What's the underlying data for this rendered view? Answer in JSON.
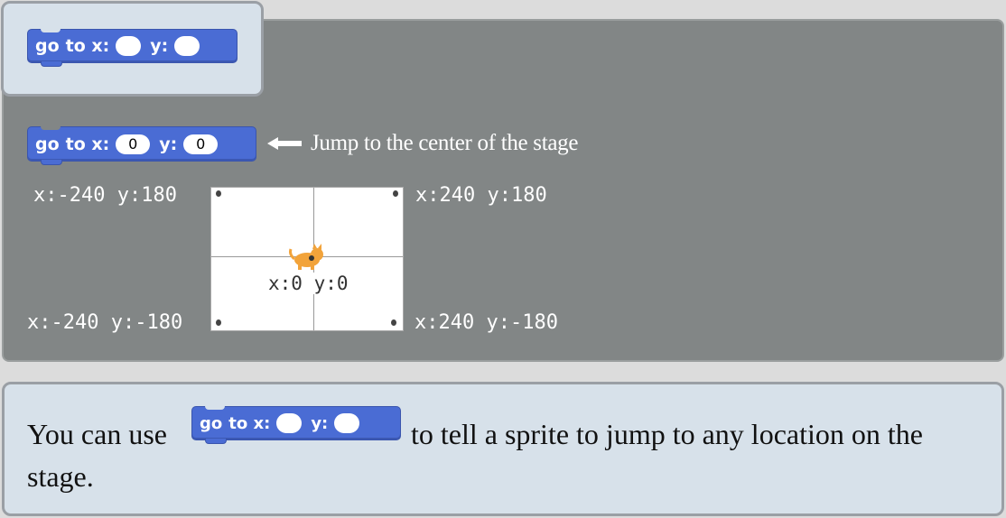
{
  "block": {
    "text_go": "go",
    "text_to_x": "to x:",
    "text_y": "y:"
  },
  "example_block": {
    "x_value": "0",
    "y_value": "0"
  },
  "hint": "Jump to the center of the stage",
  "stage": {
    "top_left": "x:-240 y:180",
    "top_right": "x:240 y:180",
    "bottom_left": "x:-240 y:-180",
    "bottom_right": "x:240 y:-180",
    "center": "x:0 y:0"
  },
  "caption": {
    "before": "You can use",
    "after": "to tell a sprite to jump to any location on the stage."
  },
  "colors": {
    "block_blue": "#4a6cd4",
    "panel_gray": "#828686",
    "card_blue": "#d7e1ea"
  }
}
